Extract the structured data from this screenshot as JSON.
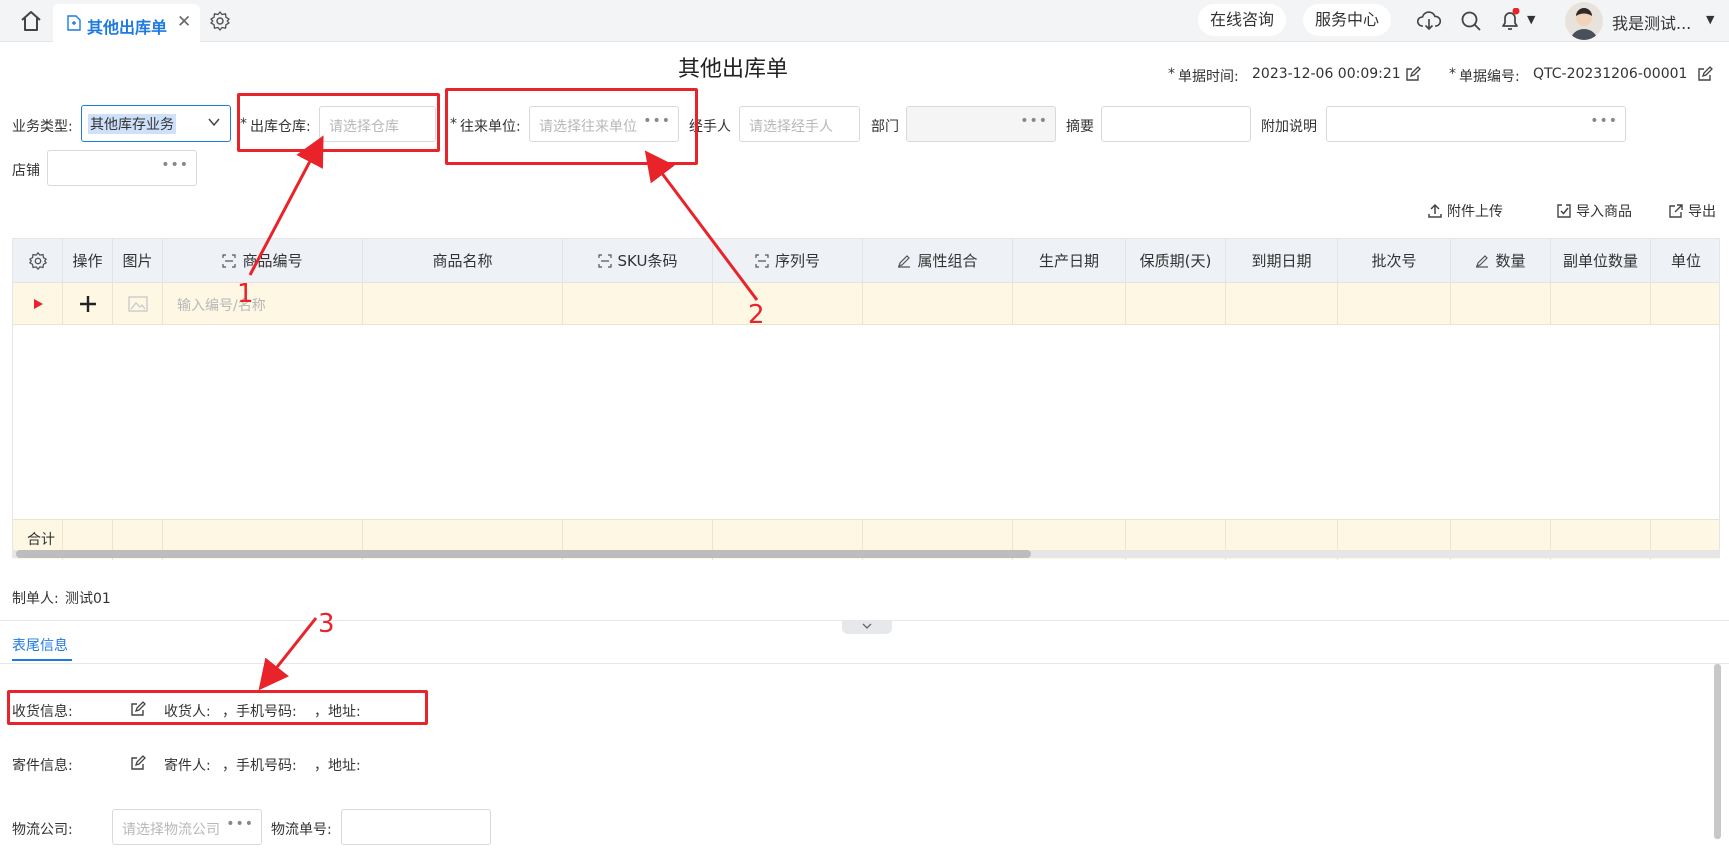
{
  "topbar": {
    "tab_label": "其他出库单",
    "consult_label": "在线咨询",
    "service_label": "服务中心",
    "user_name": "我是测试..."
  },
  "page": {
    "title": "其他出库单",
    "doc_time_label": "单据时间:",
    "doc_time_value": "2023-12-06 00:09:21",
    "doc_no_label": "单据编号:",
    "doc_no_value": "QTC-20231206-00001",
    "required_mark": "*"
  },
  "form": {
    "biz_type_label": "业务类型:",
    "biz_type_value": "其他库存业务",
    "warehouse_label": "出库仓库:",
    "warehouse_placeholder": "请选择仓库",
    "partner_label": "往来单位:",
    "partner_placeholder": "请选择往来单位",
    "handler_label": "经手人",
    "handler_placeholder": "请选择经手人",
    "dept_label": "部门",
    "summary_label": "摘要",
    "remark_label": "附加说明",
    "shop_label": "店铺"
  },
  "annotations": {
    "n1": "1",
    "n2": "2",
    "n3": "3"
  },
  "toolbar": {
    "upload_label": "附件上传",
    "import_label": "导入商品",
    "export_label": "导出"
  },
  "grid": {
    "columns": [
      "操作",
      "图片",
      "商品编号",
      "商品名称",
      "SKU条码",
      "序列号",
      "属性组合",
      "生产日期",
      "保质期(天)",
      "到期日期",
      "批次号",
      "数量",
      "副单位数量",
      "单位"
    ],
    "input_placeholder": "输入编号/名称",
    "total_label": "合计"
  },
  "footer": {
    "creator_label": "制单人:",
    "creator_value": "测试01",
    "tab_label": "表尾信息",
    "receive_label": "收货信息:",
    "receiver_label": "收货人:",
    "phone_label": "，手机号码:",
    "address_label": "，地址:",
    "send_label": "寄件信息:",
    "sender_label": "寄件人:",
    "logistics_label": "物流公司:",
    "logistics_placeholder": "请选择物流公司",
    "tracking_label": "物流单号:"
  },
  "colors": {
    "accent": "#1f7ae0",
    "annotation_red": "#e8242a",
    "row_highlight": "#fdf7e4"
  }
}
